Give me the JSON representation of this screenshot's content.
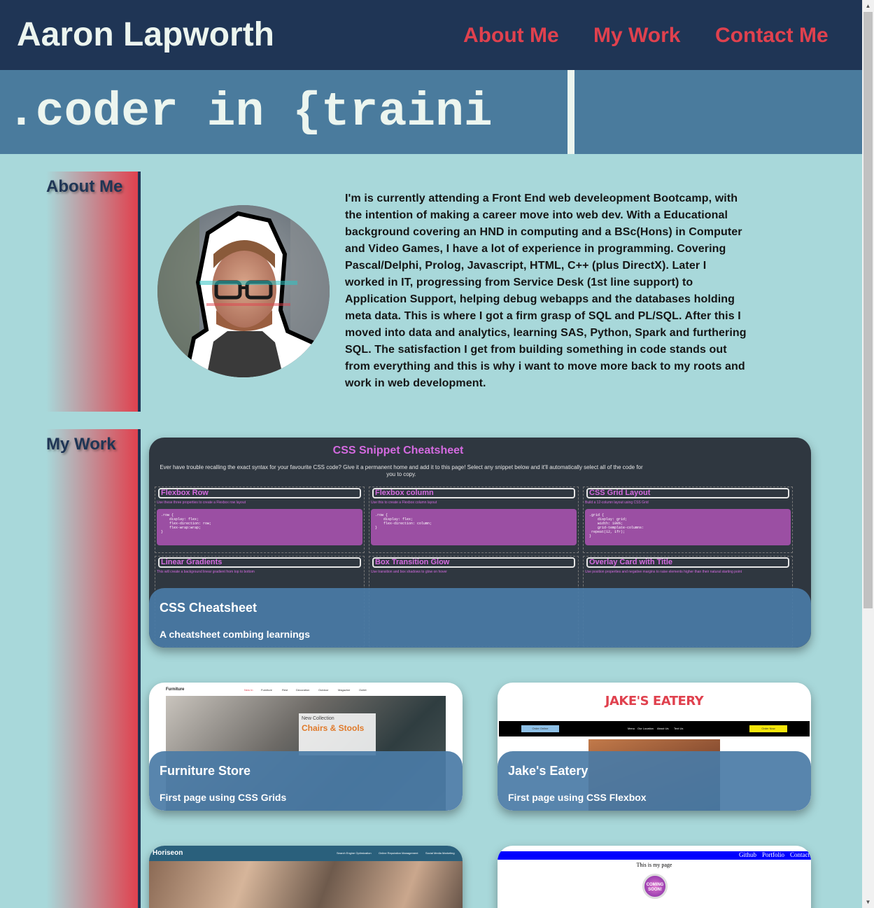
{
  "header": {
    "site_title": "Aaron Lapworth",
    "nav": [
      "About Me",
      "My Work",
      "Contact Me"
    ]
  },
  "banner": {
    "typed_text": ".coder in {traini"
  },
  "about": {
    "heading": "About Me",
    "bio": "I'm is currently attending a Front End web develeopment Bootcamp, with the intention of making a career move into web dev. With a Educational background covering an HND in computing and a BSc(Hons) in Computer and Video Games, I have a lot of experience in programming. Covering Pascal/Delphi, Prolog, Javascript, HTML, C++ (plus DirectX). Later I worked in IT, progressing from Service Desk (1st line support) to Application Support, helping debug webapps and the databases holding meta data. This is where I got a firm grasp of SQL and PL/SQL. After this I moved into data and analytics, learning SAS, Python, Spark and furthering SQL. The satisfaction I get from building something in code stands out from everything and this is why i want to move more back to my roots and work in web development."
  },
  "work": {
    "heading": "My Work",
    "projects": [
      {
        "title": "CSS Cheatsheet",
        "description": "A cheatsheet combing learnings",
        "preview": {
          "heading": "CSS Snippet Cheatsheet",
          "intro": "Ever have trouble recalling the exact syntax for your favourite CSS code? Give it a permanent home and add it to this page! Select any snippet below and it'll automatically select all of the code for you to copy.",
          "snippets": [
            {
              "name": "Flexbox Row",
              "hint": "Use these three properties to create a Flexbox row layout",
              "code": ".row {\n    display: flex;\n    flex-direction: row;\n    flex-wrap:wrap;\n}"
            },
            {
              "name": "Flexbox column",
              "hint": "Use this to create a Flexbox column layout",
              "code": ".row {\n    display: flex;\n    flex-direction: column;\n}"
            },
            {
              "name": "CSS Grid Layout",
              "hint": "Build a 12-column layout using CSS Grid",
              "code": ".grid {\n    display: grid;\n    width: 100%;\n    grid-template-columns:\n repeat(12, 1fr);\n}"
            },
            {
              "name": "Linear Gradients",
              "hint": "This will create a background linear gradient from top to bottom",
              "code": ""
            },
            {
              "name": "Box Transition Glow",
              "hint": "Use transition and box shadows to glow on hover",
              "code": ""
            },
            {
              "name": "Overlay Card with Title",
              "hint": "Use position properties and negative margins to raise elements higher than their natural starting point",
              "code": ""
            }
          ]
        }
      },
      {
        "title": "Furniture Store",
        "description": "First page using CSS Grids",
        "preview": {
          "brand": "Furniture",
          "nav": [
            "New In",
            "Furniture",
            "Rest",
            "Decoration",
            "Outdoor",
            "Magazine",
            "Outlet"
          ],
          "collection_label": "New Collection",
          "collection_title": "Chairs & Stools"
        }
      },
      {
        "title": "Jake's Eatery",
        "description": "First page using CSS Flexbox",
        "preview": {
          "logo": "JAKE'S EATERY",
          "nav": [
            "Menu",
            "Our Location",
            "About Us",
            "Text Us"
          ],
          "left_button": "Order Online",
          "right_button": "Order Now"
        }
      },
      {
        "title": "",
        "description": "",
        "preview": {
          "brand": "Horiseon",
          "nav": [
            "Search Engine Optimization",
            "Online Reputation Management",
            "Social Media Marketing"
          ]
        }
      },
      {
        "title": "",
        "description": "",
        "preview": {
          "nav": [
            "Github",
            "Portfolio",
            "Contact"
          ],
          "heading": "This is my page",
          "badge": "COMING SOON!"
        }
      }
    ]
  },
  "colors": {
    "header_bg": "#1f3555",
    "banner_bg": "#4a7b9d",
    "page_bg": "#a8d8da",
    "accent": "#e0414e",
    "card_overlay": "#4a7ba6"
  }
}
